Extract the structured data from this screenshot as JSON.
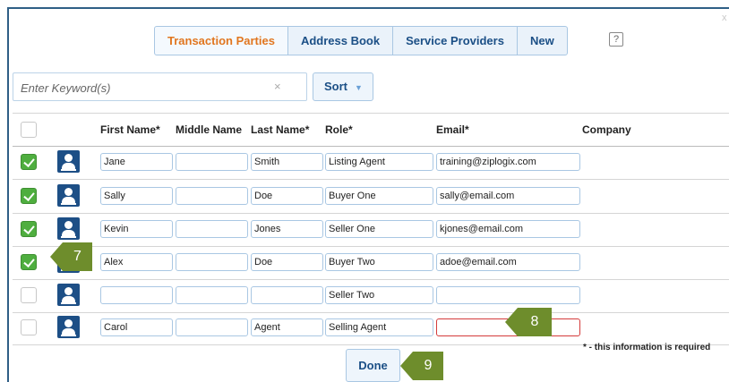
{
  "window": {
    "close_label": "x"
  },
  "tabs": [
    {
      "label": "Transaction Parties",
      "active": true
    },
    {
      "label": "Address Book",
      "active": false
    },
    {
      "label": "Service Providers",
      "active": false
    },
    {
      "label": "New",
      "active": false
    }
  ],
  "help": {
    "icon": "help-icon",
    "label": "?"
  },
  "search": {
    "placeholder": "Enter Keyword(s)",
    "value": "",
    "clear_label": "×"
  },
  "sort": {
    "label": "Sort",
    "caret": "▼"
  },
  "table": {
    "headers": {
      "first_name": "First Name*",
      "middle_name": "Middle Name",
      "last_name": "Last Name*",
      "role": "Role*",
      "email": "Email*",
      "company": "Company"
    },
    "rows": [
      {
        "checked": true,
        "first": "Jane",
        "middle": "",
        "last": "Smith",
        "role": "Listing Agent",
        "email": "training@ziplogix.com"
      },
      {
        "checked": true,
        "first": "Sally",
        "middle": "",
        "last": "Doe",
        "role": "Buyer One",
        "email": "sally@email.com"
      },
      {
        "checked": true,
        "first": "Kevin",
        "middle": "",
        "last": "Jones",
        "role": "Seller One",
        "email": "kjones@email.com"
      },
      {
        "checked": true,
        "first": "Alex",
        "middle": "",
        "last": "Doe",
        "role": "Buyer Two",
        "email": "adoe@email.com"
      },
      {
        "checked": false,
        "first": "",
        "middle": "",
        "last": "",
        "role": "Seller Two",
        "email": ""
      },
      {
        "checked": false,
        "first": "Carol",
        "middle": "",
        "last": "Agent",
        "role": "Selling Agent",
        "email": "",
        "email_error": true
      }
    ]
  },
  "callouts": {
    "step7": "7",
    "step8": "8",
    "step9": "9"
  },
  "required_note": "* - this information is required",
  "done_label": "Done",
  "colors": {
    "accent": "#e1761f",
    "link": "#1b4f86",
    "check": "#4fae3f",
    "callout": "#6e8d2c",
    "error": "#d43b3b"
  }
}
